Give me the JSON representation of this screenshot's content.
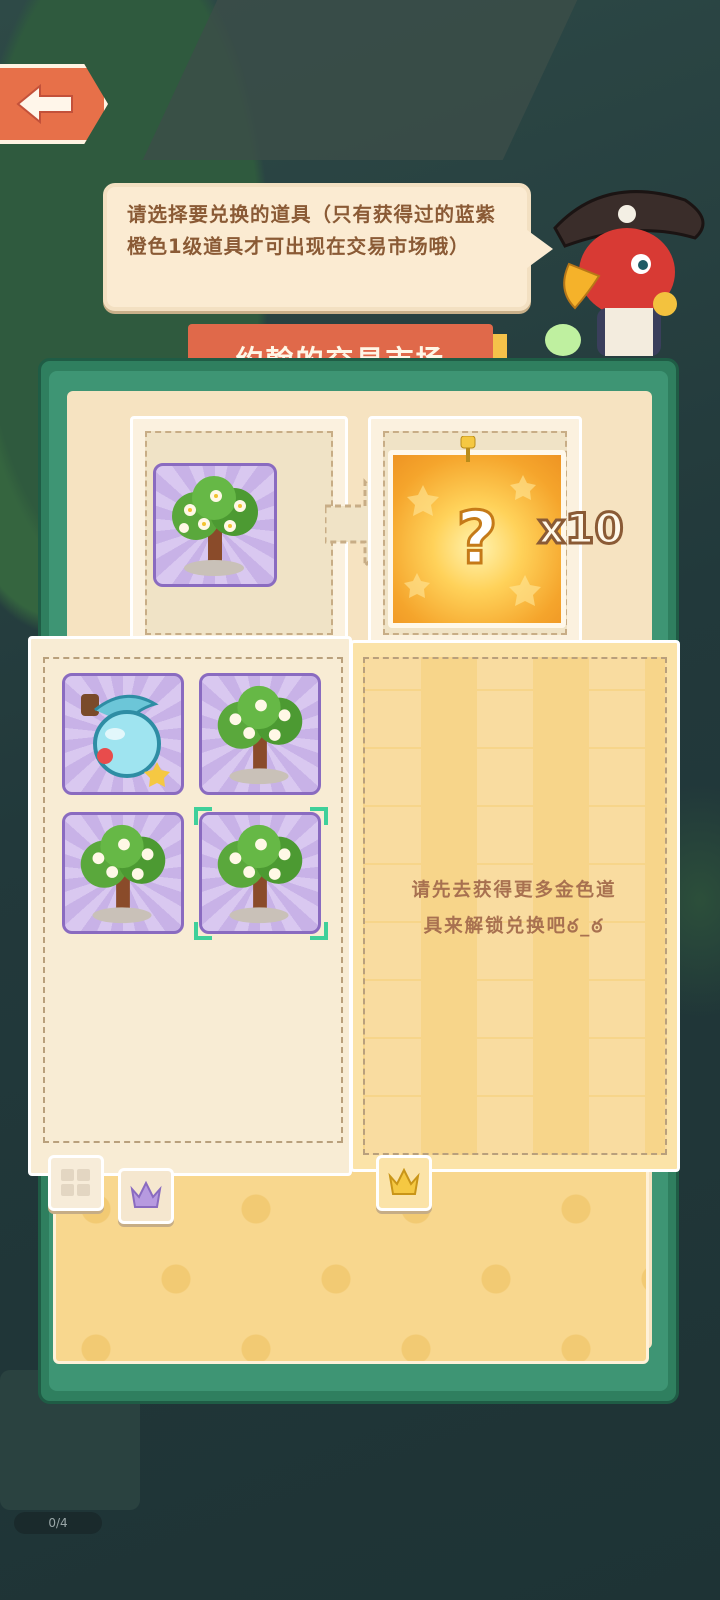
{
  "screen": {
    "bubble_text": "请选择要兑换的道具（只有获得过的蓝紫橙色1级道具才可出现在交易市场哦）",
    "title": "约翰的交易市场",
    "multiplier": "x10",
    "locked_message": "请先去获得更多金色道具来解锁兑换吧ఠ_ఠ",
    "progress": "0/4",
    "selected_tab": "purple-crown",
    "selected_item_index": 3
  },
  "source_item": {
    "name": "flower-tree",
    "rarity": "purple"
  },
  "target_reward": {
    "name": "mystery-box"
  },
  "items": [
    {
      "name": "potion-bottle",
      "rarity": "purple"
    },
    {
      "name": "flower-tree",
      "rarity": "purple"
    },
    {
      "name": "flower-tree",
      "rarity": "purple"
    },
    {
      "name": "flower-tree",
      "rarity": "purple"
    }
  ],
  "colors": {
    "board_green": "#2f7f5f",
    "banner": "#e0694a",
    "purple_tile": "#8a6bc0",
    "gold": "#f5a52c",
    "selection": "#3fd09a"
  }
}
